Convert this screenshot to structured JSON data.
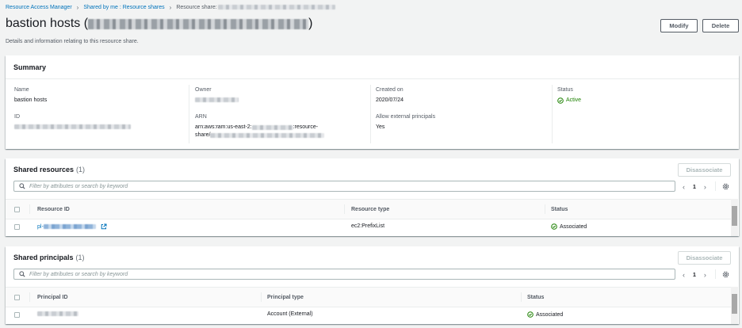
{
  "breadcrumb": {
    "items": [
      "Resource Access Manager",
      "Shared by me : Resource shares",
      "Resource share:"
    ]
  },
  "page": {
    "title": "bastion hosts (",
    "title_close": ")",
    "description": "Details and information relating to this resource share.",
    "modify_label": "Modify",
    "delete_label": "Delete"
  },
  "summary": {
    "title": "Summary",
    "name_label": "Name",
    "name_value": "bastion hosts",
    "owner_label": "Owner",
    "created_label": "Created on",
    "created_value": "2020/07/24",
    "status_label": "Status",
    "status_value": "Active",
    "id_label": "ID",
    "arn_label": "ARN",
    "arn_prefix": "arn:aws:ram:us-east-2:",
    "arn_mid": ":resource-",
    "arn_line2_prefix": "share/",
    "allow_label": "Allow external principals",
    "allow_value": "Yes"
  },
  "shared_resources": {
    "title": "Shared resources",
    "count": "(1)",
    "disassociate_label": "Disassociate",
    "filter_placeholder": "Filter by attributes or search by keyword",
    "page_number": "1",
    "columns": [
      "Resource ID",
      "Resource type",
      "Status"
    ],
    "rows": [
      {
        "id_prefix": "pl-",
        "type": "ec2:PrefixList",
        "status": "Associated"
      }
    ]
  },
  "shared_principals": {
    "title": "Shared principals",
    "count": "(1)",
    "disassociate_label": "Disassociate",
    "filter_placeholder": "Filter by attributes or search by keyword",
    "page_number": "1",
    "columns": [
      "Principal ID",
      "Principal type",
      "Status"
    ],
    "rows": [
      {
        "type": "Account (External)",
        "status": "Associated"
      }
    ]
  },
  "colors": {
    "link": "#0073bb",
    "success": "#1d8102",
    "border": "#eaeded"
  }
}
